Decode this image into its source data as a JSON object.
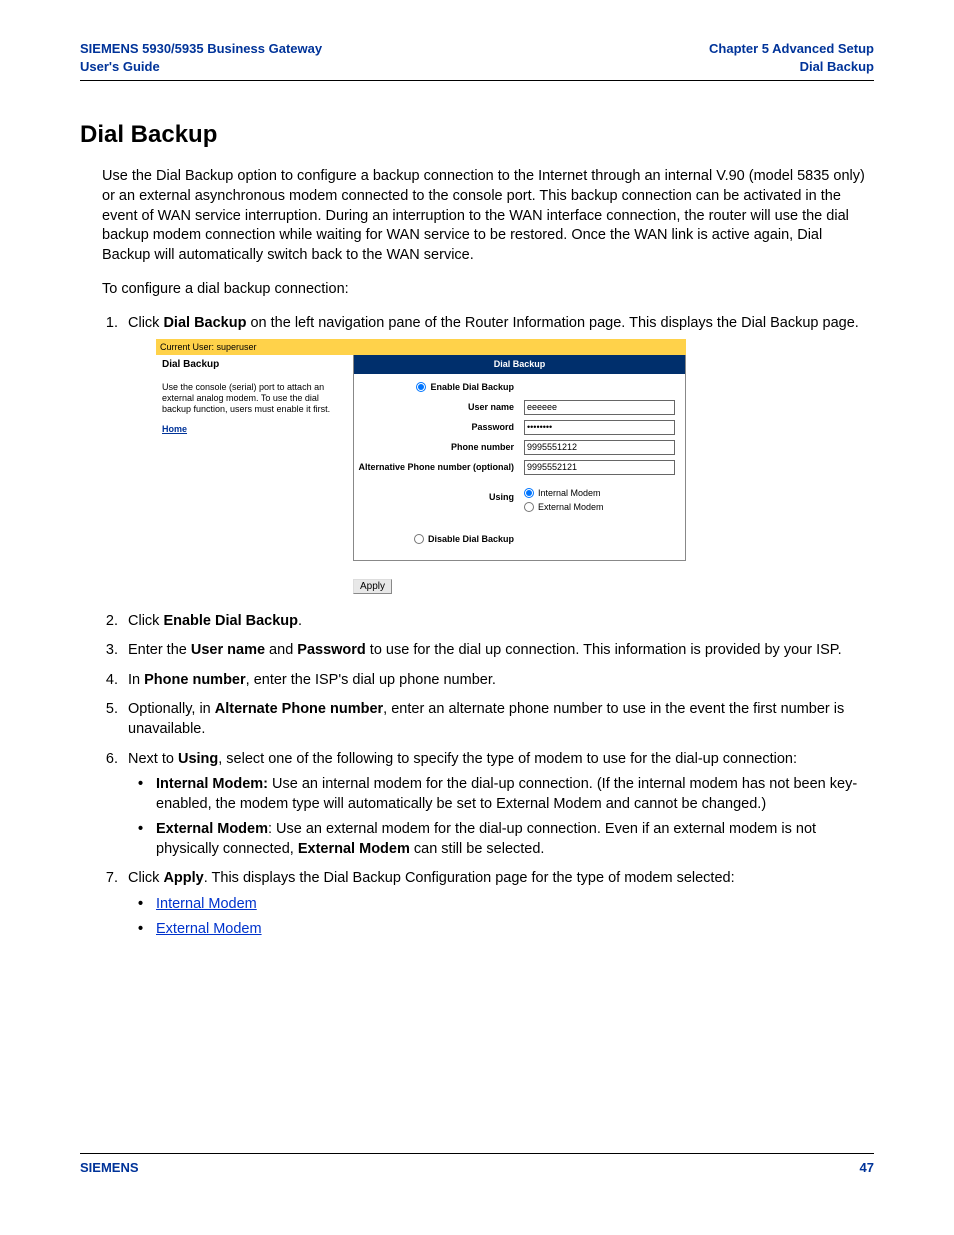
{
  "header": {
    "doc_title_l1": "SIEMENS 5930/5935 Business Gateway",
    "doc_title_l2": "User's Guide",
    "chapter": "Chapter 5  Advanced Setup",
    "section": "Dial Backup"
  },
  "title": "Dial Backup",
  "intro": "Use the Dial Backup option to configure a backup connection to the Internet through an internal V.90 (model 5835 only) or an external asynchronous modem connected to the console port. This backup connection can be activated in the event of WAN service interruption. During an interruption to the WAN interface connection, the router will use the dial backup modem connection while waiting for WAN service to be restored. Once the WAN link is active again, Dial Backup will automatically switch back to the WAN service.",
  "lead": "To configure a dial backup connection:",
  "steps": {
    "s1_a": "Click ",
    "s1_b": "Dial Backup",
    "s1_c": " on the left navigation pane of the Router Information page. This displays the Dial Backup page.",
    "s2_a": "Click ",
    "s2_b": "Enable Dial Backup",
    "s2_c": ".",
    "s3_a": "Enter the ",
    "s3_b": "User name",
    "s3_c": " and ",
    "s3_d": "Password",
    "s3_e": " to use for the dial up connection. This information is provided by your ISP.",
    "s4_a": "In ",
    "s4_b": "Phone number",
    "s4_c": ", enter the ISP's dial up phone number.",
    "s5_a": "Optionally, in ",
    "s5_b": "Alternate Phone number",
    "s5_c": ", enter an alternate phone number to use in the event the first number is unavailable.",
    "s6_a": "Next to ",
    "s6_b": "Using",
    "s6_c": ", select one of the following to specify the type of modem to use for the dial-up connection:",
    "s6_bul1_a": "Internal Modem: ",
    "s6_bul1_b": "Use an internal modem for the dial-up connection. (If the internal modem has not been key-enabled, the modem type will automatically be set to External Modem and cannot be changed.)",
    "s6_bul2_a": "External Modem",
    "s6_bul2_b": ": Use an external modem for the dial-up connection. Even if an external modem is not physically connected, ",
    "s6_bul2_c": "External Modem",
    "s6_bul2_d": " can still be selected.",
    "s7_a": "Click ",
    "s7_b": "Apply",
    "s7_c": ". This displays the Dial Backup Configuration page for the type of modem selected:",
    "s7_link1": "Internal Modem",
    "s7_link2": "External Modem"
  },
  "shot": {
    "current_user": "Current User: superuser",
    "left_title": "Dial Backup",
    "left_desc": "Use the console (serial) port to attach an external analog modem.  To use the dial backup function, users must enable it first.",
    "home": "Home",
    "panel_title": "Dial Backup",
    "enable_label": "Enable Dial Backup",
    "user_label": "User name",
    "user_value": "eeeeee",
    "pass_label": "Password",
    "pass_value": "xxxxxxxx",
    "phone_label": "Phone number",
    "phone_value": "9995551212",
    "alt_label": "Alternative Phone number (optional)",
    "alt_value": "9995552121",
    "using_label": "Using",
    "internal": "Internal Modem",
    "external": "External Modem",
    "disable_label": "Disable Dial Backup",
    "apply": "Apply"
  },
  "footer": {
    "brand": "SIEMENS",
    "page": "47"
  }
}
